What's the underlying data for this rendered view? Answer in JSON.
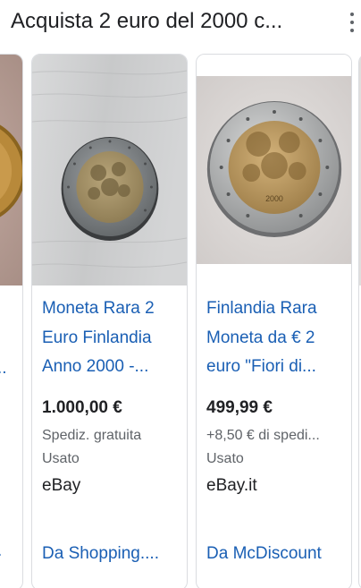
{
  "header": {
    "title": "Acquista 2 euro del 2000 c..."
  },
  "cards": [
    {
      "title": "Moneta Rara 2 Euro Finlandia Anno 2000 -...",
      "price": "1.000,00 €",
      "shipping": "Spediz. gratuita",
      "condition": "Usato",
      "seller": "eBay",
      "source": "Da Shopping...."
    },
    {
      "title": "Finlandia Rara Moneta da € 2 euro \"Fiori di...",
      "price": "499,99 €",
      "shipping": "+8,50 € di spedi...",
      "condition": "Usato",
      "seller": "eBay.it",
      "source": "Da McDiscount"
    }
  ],
  "left_partial": {
    "title_dots": "..",
    "source_dots": "."
  },
  "colors": {
    "link": "#1a5fb4",
    "text": "#202124",
    "muted": "#5f6368",
    "border": "#dadce0"
  },
  "icons": [
    "more-vert-icon"
  ]
}
